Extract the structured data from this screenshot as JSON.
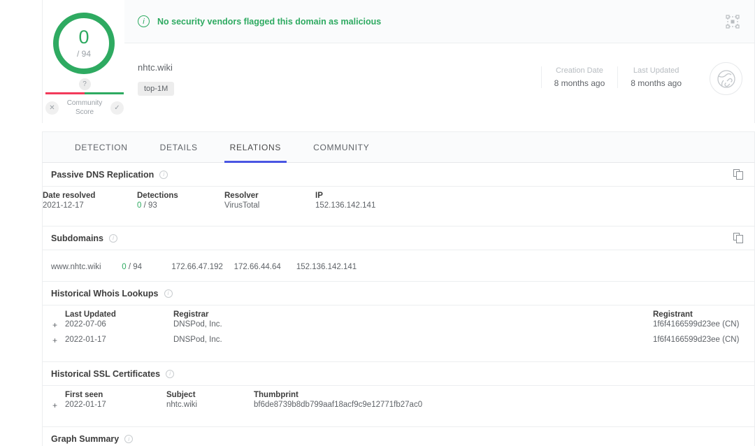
{
  "detection": {
    "score": "0",
    "total": "/ 94",
    "verdict": "No security vendors flagged this domain as malicious",
    "verdict_color": "#2eaa61",
    "info_icon": "info-icon",
    "expand_icon": "fullscreen-icon"
  },
  "community": {
    "question_mark": "?",
    "label_line1": "Community",
    "label_line2": "Score",
    "downvote_icon": "✕",
    "upvote_icon": "✓"
  },
  "meta": {
    "domain": "nhtc.wiki",
    "tag": "top-1M",
    "creation_label": "Creation Date",
    "creation_value": "8 months ago",
    "updated_label": "Last Updated",
    "updated_value": "8 months ago",
    "globe_icon": "globe-link-icon"
  },
  "tabs": [
    {
      "label": "DETECTION",
      "active": false
    },
    {
      "label": "DETAILS",
      "active": false
    },
    {
      "label": "RELATIONS",
      "active": true
    },
    {
      "label": "COMMUNITY",
      "active": false
    }
  ],
  "passive_dns": {
    "title": "Passive DNS Replication",
    "headers": [
      "Date resolved",
      "Detections",
      "Resolver",
      "IP"
    ],
    "rows": [
      {
        "date": "2021-12-17",
        "detections_count": "0",
        "detections_total": "/ 93",
        "resolver": "VirusTotal",
        "ip": "152.136.142.141"
      }
    ]
  },
  "subdomains": {
    "title": "Subdomains",
    "rows": [
      {
        "name": "www.nhtc.wiki",
        "detections_count": "0",
        "detections_total": "/ 94",
        "ip1": "172.66.47.192",
        "ip2": "172.66.44.64",
        "ip3": "152.136.142.141"
      }
    ]
  },
  "whois": {
    "title": "Historical Whois Lookups",
    "headers": [
      "Last Updated",
      "Registrar",
      "Registrant"
    ],
    "rows": [
      {
        "expand": "+",
        "last_updated": "2022-07-06",
        "registrar": "DNSPod, Inc.",
        "registrant": "1f6f4166599d23ee (CN)"
      },
      {
        "expand": "+",
        "last_updated": "2022-01-17",
        "registrar": "DNSPod, Inc.",
        "registrant": "1f6f4166599d23ee (CN)"
      }
    ]
  },
  "ssl": {
    "title": "Historical SSL Certificates",
    "headers": [
      "First seen",
      "Subject",
      "Thumbprint"
    ],
    "rows": [
      {
        "expand": "+",
        "first_seen": "2022-01-17",
        "subject": "nhtc.wiki",
        "thumbprint": "bf6de8739b8db799aaf18acf9c9e12771fb27ac0"
      }
    ]
  },
  "graph_summary": {
    "title": "Graph Summary"
  }
}
